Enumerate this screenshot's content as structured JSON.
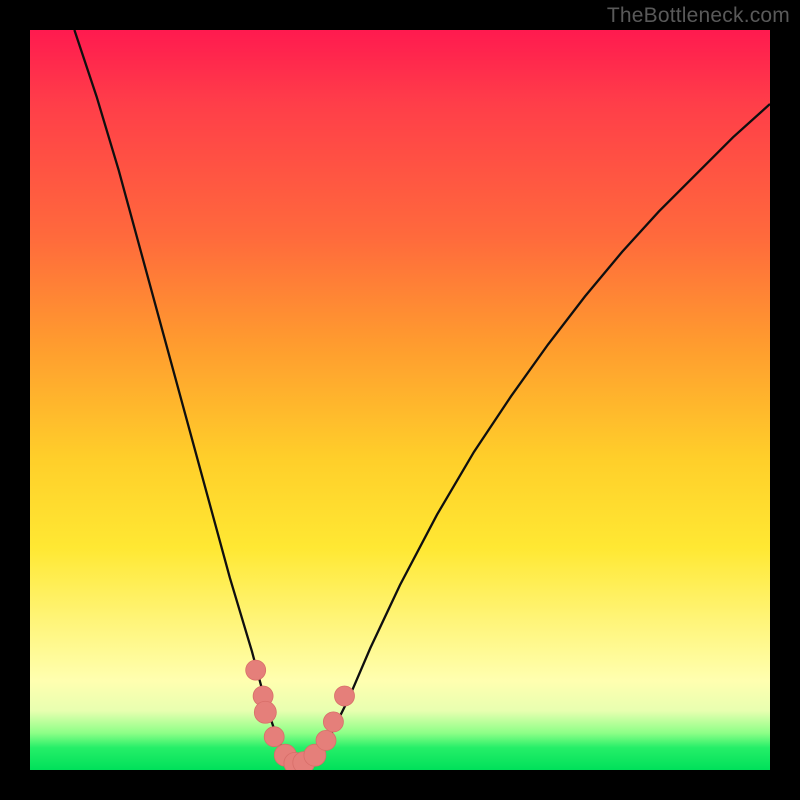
{
  "watermark": "TheBottleneck.com",
  "colors": {
    "curve_stroke": "#0f0f0f",
    "marker_fill": "#e57f7a",
    "marker_stroke": "#d86e69"
  },
  "chart_data": {
    "type": "line",
    "title": "",
    "xlabel": "",
    "ylabel": "",
    "xlim": [
      0,
      1
    ],
    "ylim": [
      0,
      1
    ],
    "series": [
      {
        "name": "bottleneck-curve",
        "x": [
          0.06,
          0.09,
          0.12,
          0.15,
          0.18,
          0.21,
          0.24,
          0.27,
          0.3,
          0.32,
          0.33,
          0.34,
          0.35,
          0.36,
          0.37,
          0.38,
          0.4,
          0.43,
          0.46,
          0.5,
          0.55,
          0.6,
          0.65,
          0.7,
          0.75,
          0.8,
          0.85,
          0.9,
          0.95,
          1.0
        ],
        "y": [
          1.0,
          0.91,
          0.81,
          0.7,
          0.59,
          0.48,
          0.37,
          0.26,
          0.16,
          0.085,
          0.055,
          0.03,
          0.012,
          0.003,
          0.003,
          0.012,
          0.035,
          0.095,
          0.165,
          0.25,
          0.345,
          0.43,
          0.505,
          0.575,
          0.64,
          0.7,
          0.755,
          0.805,
          0.855,
          0.9
        ]
      }
    ],
    "markers": [
      {
        "x": 0.305,
        "y": 0.135,
        "size": 10
      },
      {
        "x": 0.315,
        "y": 0.1,
        "size": 10
      },
      {
        "x": 0.318,
        "y": 0.078,
        "size": 11
      },
      {
        "x": 0.33,
        "y": 0.045,
        "size": 10
      },
      {
        "x": 0.345,
        "y": 0.02,
        "size": 11
      },
      {
        "x": 0.358,
        "y": 0.009,
        "size": 11
      },
      {
        "x": 0.37,
        "y": 0.01,
        "size": 11
      },
      {
        "x": 0.385,
        "y": 0.02,
        "size": 11
      },
      {
        "x": 0.4,
        "y": 0.04,
        "size": 10
      },
      {
        "x": 0.41,
        "y": 0.065,
        "size": 10
      },
      {
        "x": 0.425,
        "y": 0.1,
        "size": 10
      }
    ]
  }
}
